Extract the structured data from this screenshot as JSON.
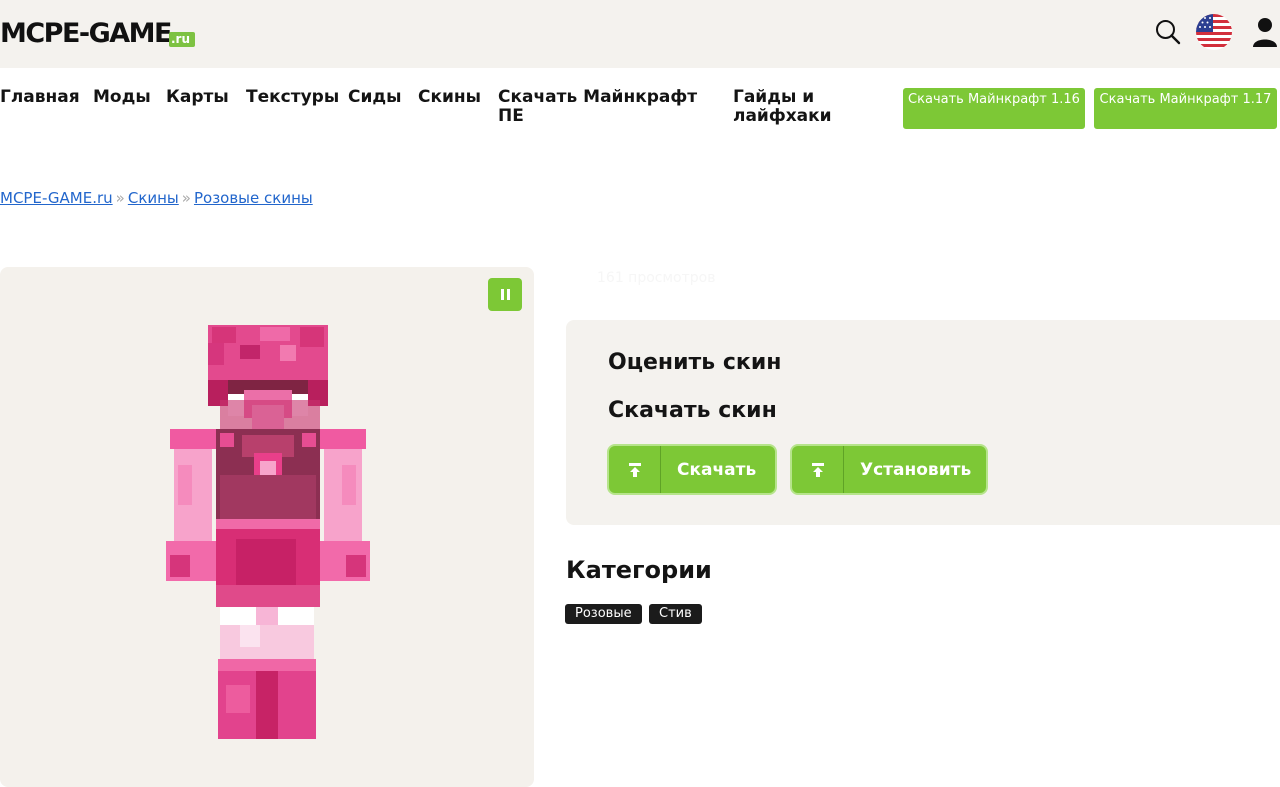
{
  "site": {
    "logo_main": "MCPE-GAME",
    "logo_suffix": ".ru"
  },
  "nav": {
    "items": [
      "Главная",
      "Моды",
      "Карты",
      "Текстуры",
      "Сиды",
      "Скины",
      "Скачать Майнкрафт ПЕ",
      "Гайды и лайфхаки"
    ],
    "download_buttons": [
      "Скачать Майнкрафт 1.16",
      "Скачать Майнкрафт 1.17"
    ]
  },
  "breadcrumb": {
    "items": [
      "MCPE-GAME.ru",
      "Скины",
      "Розовые скины"
    ],
    "separator": "»"
  },
  "skin": {
    "views": "161 просмотров"
  },
  "card": {
    "rate_title": "Оценить скин",
    "download_title": "Скачать скин",
    "download_button": "Скачать",
    "install_button": "Установить"
  },
  "categories": {
    "title": "Категории",
    "tags": [
      "Розовые",
      "Стив"
    ]
  },
  "icons": {
    "search": "search-icon",
    "language": "us-flag-icon",
    "user": "user-icon",
    "pause": "pause-icon",
    "download": "download-icon"
  },
  "colors": {
    "accent": "#7dc836",
    "link": "#2266cc",
    "panel_bg": "#f4f2ee"
  }
}
